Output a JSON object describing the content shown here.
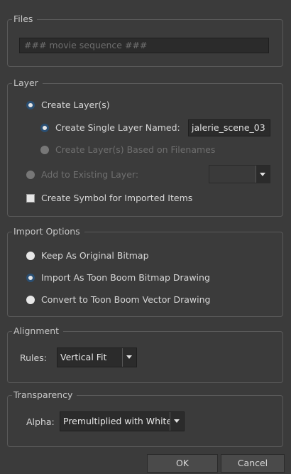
{
  "files": {
    "legend": "Files",
    "sequence_placeholder": "### movie sequence ###"
  },
  "layer": {
    "legend": "Layer",
    "create_layers_label": "Create Layer(s)",
    "create_single_label": "Create Single Layer Named:",
    "single_layer_name": "jalerie_scene_03",
    "based_on_filenames_label": "Create Layer(s) Based on Filenames",
    "add_existing_label": "Add to Existing Layer:",
    "existing_layer_value": "",
    "create_symbol_label": "Create Symbol for Imported Items"
  },
  "import_options": {
    "legend": "Import Options",
    "keep_original_label": "Keep As Original Bitmap",
    "toon_bitmap_label": "Import As Toon Boom Bitmap Drawing",
    "toon_vector_label": "Convert to Toon Boom Vector Drawing"
  },
  "alignment": {
    "legend": "Alignment",
    "rules_label": "Rules:",
    "rules_value": "Vertical Fit"
  },
  "transparency": {
    "legend": "Transparency",
    "alpha_label": "Alpha:",
    "alpha_value": "Premultiplied with White"
  },
  "buttons": {
    "ok": "OK",
    "cancel": "Cancel"
  },
  "colors": {
    "background": "#3b3b3b",
    "radio_accent": "#2a4f73"
  }
}
